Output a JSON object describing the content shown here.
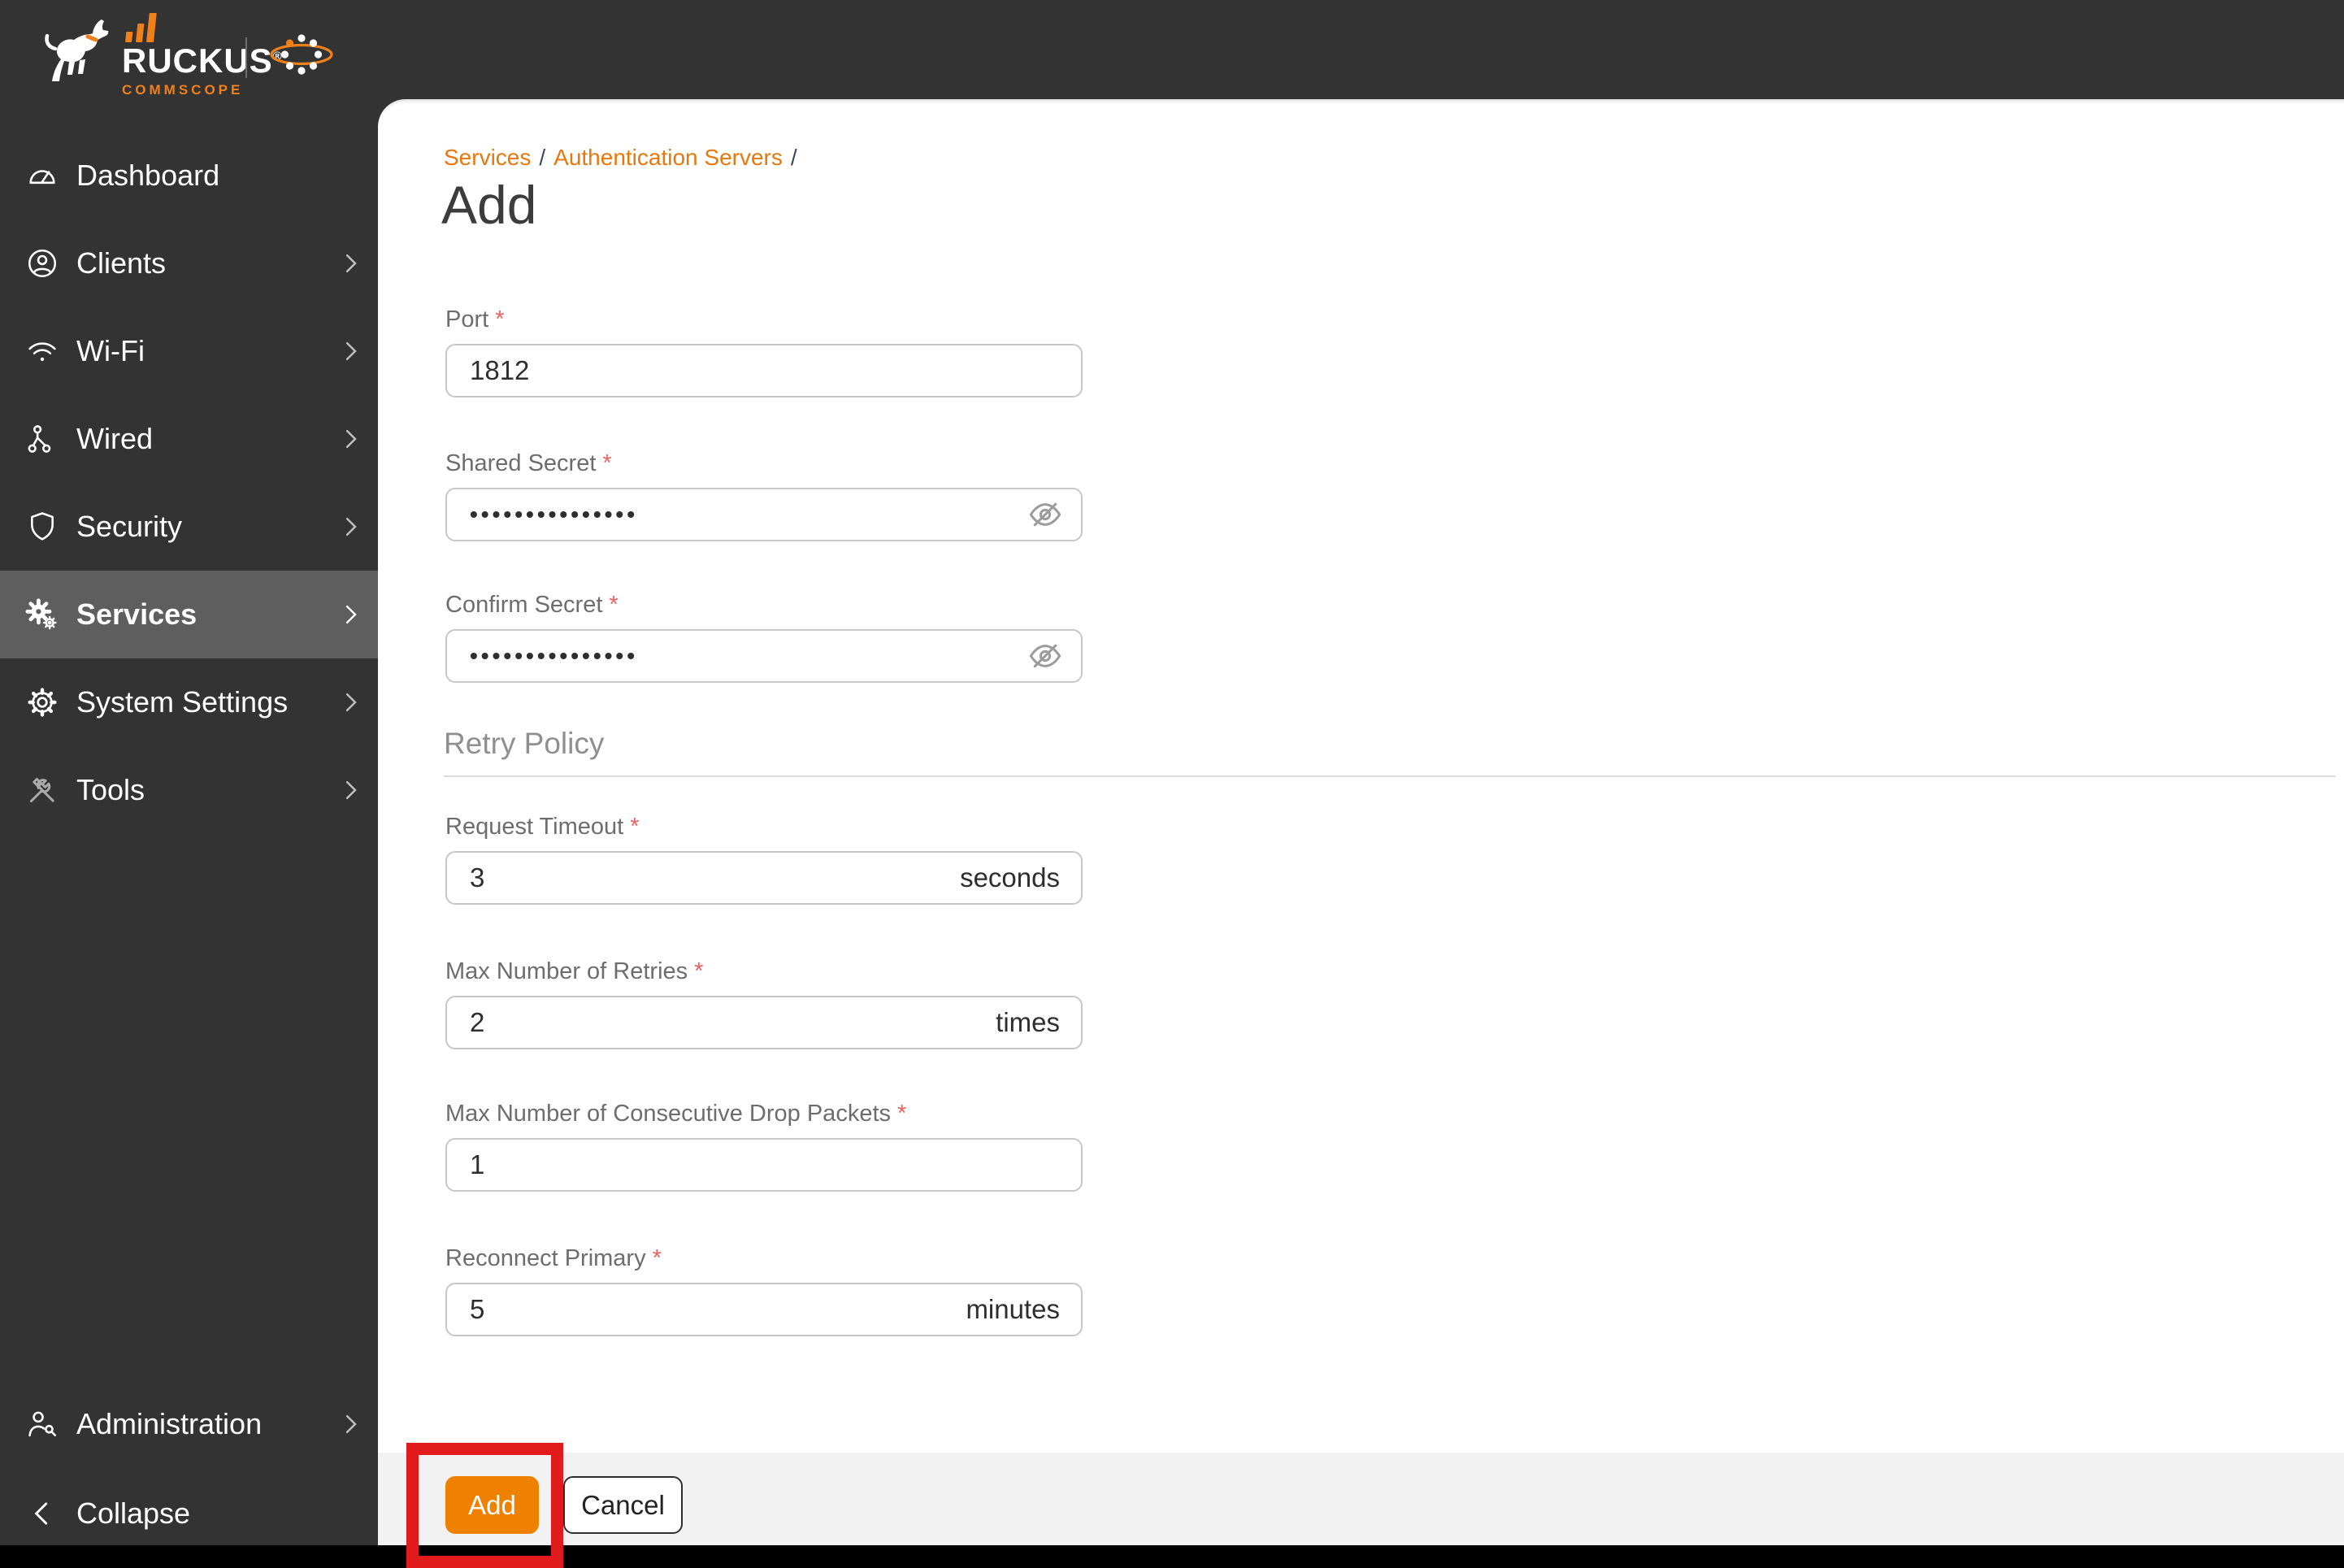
{
  "brand": {
    "name": "RUCKUS",
    "trademark": "®",
    "sub_brand": "COMMSCOPE",
    "orange": "#F08019"
  },
  "sidebar": {
    "items": [
      {
        "label": "Dashboard",
        "has_chevron": false,
        "selected": false
      },
      {
        "label": "Clients",
        "has_chevron": true,
        "selected": false
      },
      {
        "label": "Wi-Fi",
        "has_chevron": true,
        "selected": false
      },
      {
        "label": "Wired",
        "has_chevron": true,
        "selected": false
      },
      {
        "label": "Security",
        "has_chevron": true,
        "selected": false
      },
      {
        "label": "Services",
        "has_chevron": true,
        "selected": true
      },
      {
        "label": "System Settings",
        "has_chevron": true,
        "selected": false
      },
      {
        "label": "Tools",
        "has_chevron": true,
        "selected": false
      }
    ],
    "footer_items": [
      {
        "label": "Administration",
        "has_chevron": true
      },
      {
        "label": "Collapse",
        "has_chevron": false
      }
    ]
  },
  "breadcrumb": {
    "links": [
      "Services",
      "Authentication Servers"
    ],
    "separator": "/"
  },
  "page_title": "Add",
  "form": {
    "required_marker": "*",
    "sections": {
      "retry_policy": "Retry Policy"
    },
    "fields": {
      "port": {
        "label": "Port",
        "value": "1812"
      },
      "shared_secret": {
        "label": "Shared Secret",
        "value": "•••••••••••••••"
      },
      "confirm_secret": {
        "label": "Confirm Secret",
        "value": "•••••••••••••••"
      },
      "request_timeout": {
        "label": "Request Timeout",
        "value": "3",
        "suffix": "seconds"
      },
      "max_retries": {
        "label": "Max Number of Retries",
        "value": "2",
        "suffix": "times"
      },
      "max_drop_packets": {
        "label": "Max Number of Consecutive Drop Packets",
        "value": "1"
      },
      "reconnect_primary": {
        "label": "Reconnect Primary",
        "value": "5",
        "suffix": "minutes"
      }
    }
  },
  "actions": {
    "add": "Add",
    "cancel": "Cancel"
  },
  "annotation": {
    "type": "highlight-box",
    "color": "#e11b1b"
  },
  "colors": {
    "header_bg": "#333333",
    "sidebar_selected_bg": "#5e5e5e",
    "link_orange": "#e8770e",
    "button_orange": "#ee8100",
    "footer_bar_bg": "#f2f2f2"
  }
}
